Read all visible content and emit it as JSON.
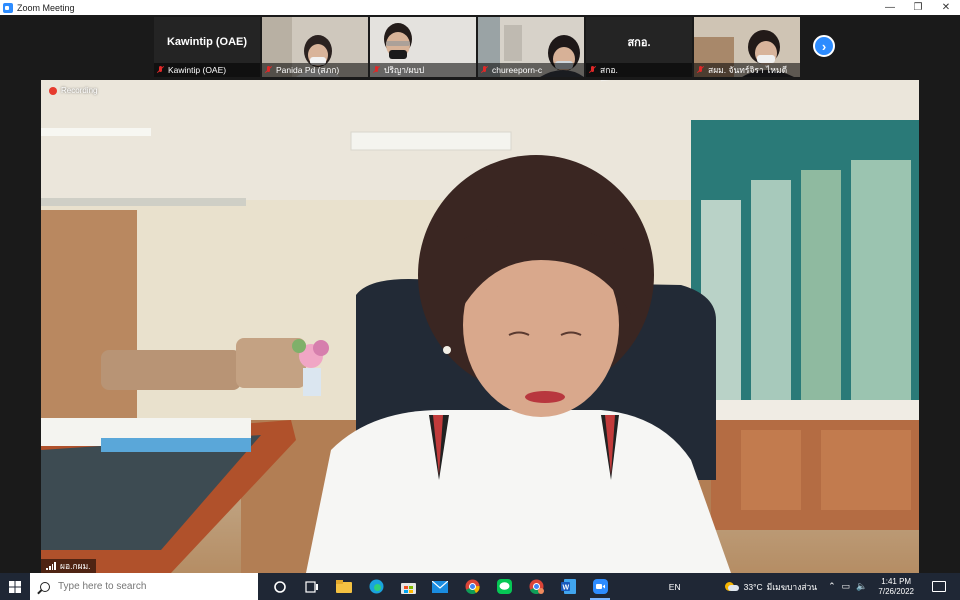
{
  "window": {
    "title": "Zoom Meeting",
    "minimize": "—",
    "maximize": "❐",
    "close": "✕"
  },
  "participants": [
    {
      "display": "Kawintip (OAE)",
      "name": "Kawintip (OAE)",
      "video": false
    },
    {
      "name": "Panida Pd (สภก)",
      "video": true
    },
    {
      "name": "ปริญา/ผบป",
      "video": true
    },
    {
      "name": "chureeporn-c",
      "video": true
    },
    {
      "display": "สกอ.",
      "name": "สกอ.",
      "video": false
    },
    {
      "name": "สผม. จันทร์จิรา ไหมดี",
      "video": true
    }
  ],
  "thumb_next_icon": "chevron-right-icon",
  "speaker": {
    "recording_label": "Recording",
    "name": "ผอ.กผม."
  },
  "taskbar": {
    "search_placeholder": "Type here to search",
    "language": "EN",
    "temperature": "33°C",
    "weather_text": "มีเมฆบางส่วน",
    "time": "1:41 PM",
    "date": "7/26/2022",
    "apps": [
      "cortana-icon",
      "task-view-icon",
      "file-explorer-icon",
      "edge-icon",
      "store-icon",
      "mail-icon",
      "chrome-icon",
      "line-icon",
      "chrome-profile-icon",
      "word-icon",
      "zoom-icon"
    ]
  },
  "colors": {
    "zoom_blue": "#2d8cff",
    "muted_red": "#e02828",
    "recording_red": "#e63b2e",
    "taskbar": "#1f2735"
  }
}
